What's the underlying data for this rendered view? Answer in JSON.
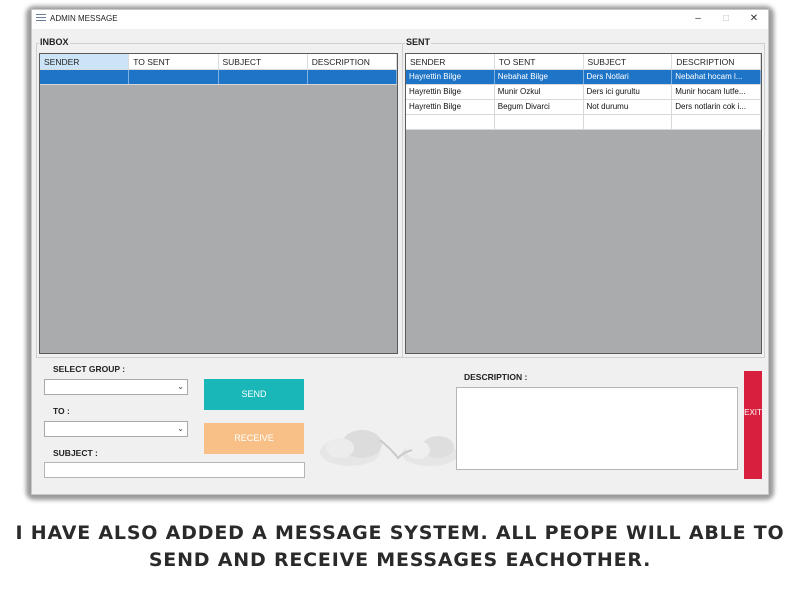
{
  "window": {
    "title": "ADMIN MESSAGE",
    "controls": {
      "minimize": "–",
      "maximize": "□",
      "close": "✕"
    }
  },
  "inbox": {
    "label": "INBOX",
    "columns": [
      "SENDER",
      "TO SENT",
      "SUBJECT",
      "DESCRIPTION"
    ],
    "rows": [
      [
        "",
        "",
        "",
        ""
      ]
    ]
  },
  "sent": {
    "label": "SENT",
    "columns": [
      "SENDER",
      "TO SENT",
      "SUBJECT",
      "DESCRIPTION"
    ],
    "rows": [
      [
        "Hayrettin Bilge",
        "Nebahat Bilge",
        "Ders Notlari",
        "Nebahat hocam l..."
      ],
      [
        "Hayrettin Bilge",
        "Munir Ozkul",
        "Ders ici gurultu",
        "Munir hocam lutfe..."
      ],
      [
        "Hayrettin Bilge",
        "Begum Divarci",
        "Not durumu",
        "Ders notlarin cok i..."
      ],
      [
        "",
        "",
        "",
        ""
      ]
    ]
  },
  "form": {
    "select_group_label": "SELECT GROUP :",
    "select_group_value": "",
    "to_label": "TO :",
    "to_value": "",
    "subject_label": "SUBJECT :",
    "subject_value": "",
    "description_label": "DESCRIPTION :",
    "description_value": ""
  },
  "buttons": {
    "send": "SEND",
    "receive": "RECEIVE",
    "exit": "EXIT"
  },
  "colors": {
    "send": "#19b7b8",
    "receive": "#f8c087",
    "exit": "#d8203e",
    "selection": "#1e74c7",
    "grid_background": "#a9abac"
  },
  "caption": "I HAVE ALSO ADDED A MESSAGE SYSTEM. ALL PEOPE WILL ABLE TO SEND AND RECEIVE MESSAGES EACHOTHER."
}
